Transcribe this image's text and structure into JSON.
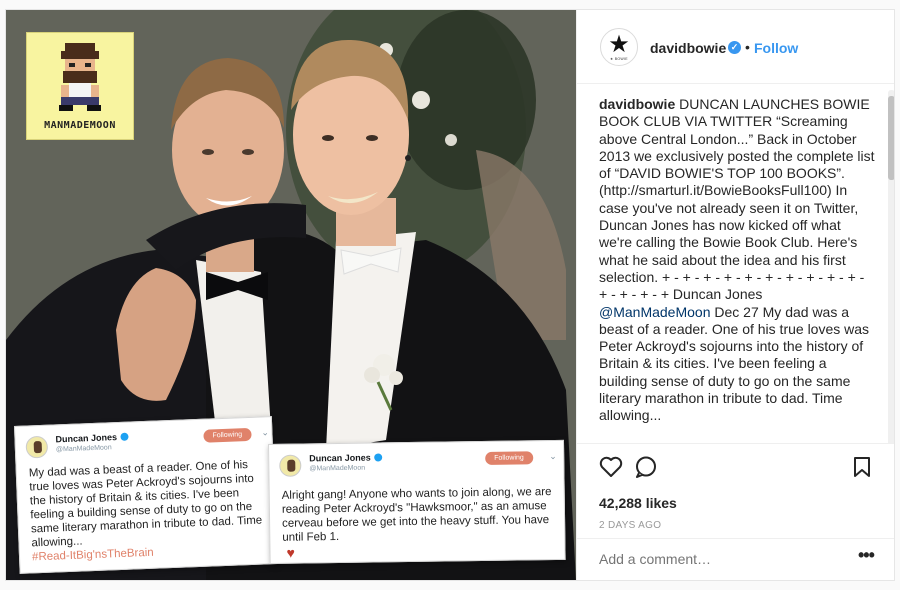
{
  "post_image": {
    "logo_text": "MANMADEMOON",
    "tweet_1": {
      "name": "Duncan Jones",
      "handle": "@ManMadeMoon",
      "follow_label": "Following",
      "text": "My dad was a beast of a reader.  One of his true loves was Peter Ackroyd's sojourns into the history of Britain & its cities.  I've been feeling a building sense of duty to go on the same literary marathon in tribute to dad. Time allowing...",
      "hashtag": "#Read-ItBig'nsTheBrain"
    },
    "tweet_2": {
      "name": "Duncan Jones",
      "handle": "@ManMadeMoon",
      "follow_label": "Following",
      "text": "Alright gang!  Anyone who wants to join along, we are reading Peter Ackroyd's \"Hawksmoor,\" as an amuse cerveau before we get into the heavy stuff.  You have until Feb 1.",
      "heart": "♥"
    }
  },
  "header": {
    "avatar_glyph": "★",
    "avatar_caption": "★ BOWIE",
    "username": "davidbowie",
    "verified_glyph": "✓",
    "separator": "•",
    "follow_label": "Follow"
  },
  "caption": {
    "username": "davidbowie",
    "part1": " DUNCAN LAUNCHES BOWIE BOOK CLUB VIA TWITTER “Screaming above Central London...” Back in October 2013 we exclusively posted the complete list of “DAVID BOWIE'S TOP 100 BOOKS”. (http://smarturl.it/BowieBooksFull100) In case you've not already seen it on Twitter, Duncan Jones has now kicked off what we're calling the Bowie Book Club. Here's what he said about the idea and his first selection. + - + - + - + - + - + - + - + - + - + - + - + - + - + Duncan Jones ",
    "mention": "@ManMadeMoon",
    "part2": " Dec 27 My dad was a beast of a reader. One of his true loves was Peter Ackroyd's sojourns into the history of Britain & its cities. I've been feeling a building sense of duty to go on the same literary marathon in tribute to dad. Time allowing..."
  },
  "actions": {
    "like_icon": "heart-outline",
    "comment_icon": "speech-bubble",
    "save_icon": "bookmark",
    "likes": "42,288 likes",
    "time": "2 DAYS AGO",
    "comment_placeholder": "Add a comment…",
    "more_label": "•••"
  },
  "colors": {
    "link": "#3897f0",
    "verified": "#3897f0",
    "text": "#262626",
    "muted": "#999999",
    "logo_bg": "#f8f4a0"
  }
}
